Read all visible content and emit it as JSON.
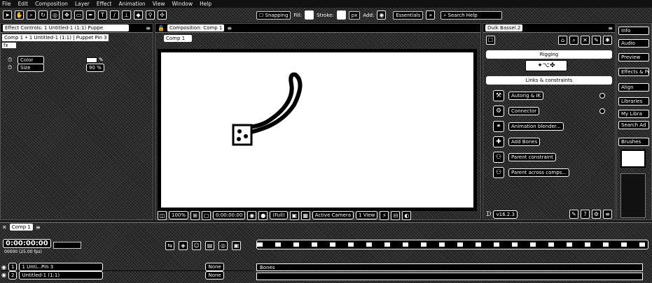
{
  "menu": [
    "File",
    "Edit",
    "Composition",
    "Layer",
    "Effect",
    "Animation",
    "View",
    "Window",
    "Help"
  ],
  "toolbar": {
    "snapping_label": "Snapping",
    "fill_label": "Fill:",
    "stroke_label": "Stroke:",
    "stroke_value": "px",
    "add_label": "Add:",
    "workspace": "Essentials",
    "search_placeholder": "Search Help"
  },
  "effect_controls": {
    "tab_label": "Effect Controls: 1 Untitled-1 (1:1) Puppe",
    "breadcrumb": "Comp 1 • 1 Untitled-1 (1:1) | Puppet Pin 3",
    "fx_label": "fx",
    "props": [
      {
        "name": "Color",
        "value": ""
      },
      {
        "name": "Size",
        "value": "90 %"
      }
    ]
  },
  "composition": {
    "tab_label": "Composition: Comp 1",
    "subtab": "Comp 1",
    "zoom": "100%",
    "timecode": "0:00:00:00",
    "resolution": "(Full)",
    "camera": "Active Camera",
    "views": "1 View"
  },
  "duik": {
    "tab_label": "Duik Bassel.2",
    "rigging_header": "Rigging",
    "links_header": "Links & constraints",
    "buttons": [
      "Autorig & IK",
      "Connector",
      "Animation blender...",
      "Add Bones",
      "Parent constraint",
      "Parent across comps..."
    ],
    "version": "v16.2.3"
  },
  "right_tabs": [
    "Info",
    "Audio",
    "Preview",
    "Effects & Pr",
    "Align",
    "Libraries",
    "My Libra",
    "Search Ad",
    "Brushes"
  ],
  "timeline": {
    "tab_label": "Comp 1",
    "timecode": "0:00:00:00",
    "fps": "00000 (25.00 fps)",
    "layers": [
      {
        "index": "1",
        "name": "1 Unti...Pin 3",
        "parent": "None"
      },
      {
        "index": "2",
        "name": "Untitled-1 (1:1)",
        "parent": "None"
      }
    ],
    "track_label": "Bones"
  }
}
